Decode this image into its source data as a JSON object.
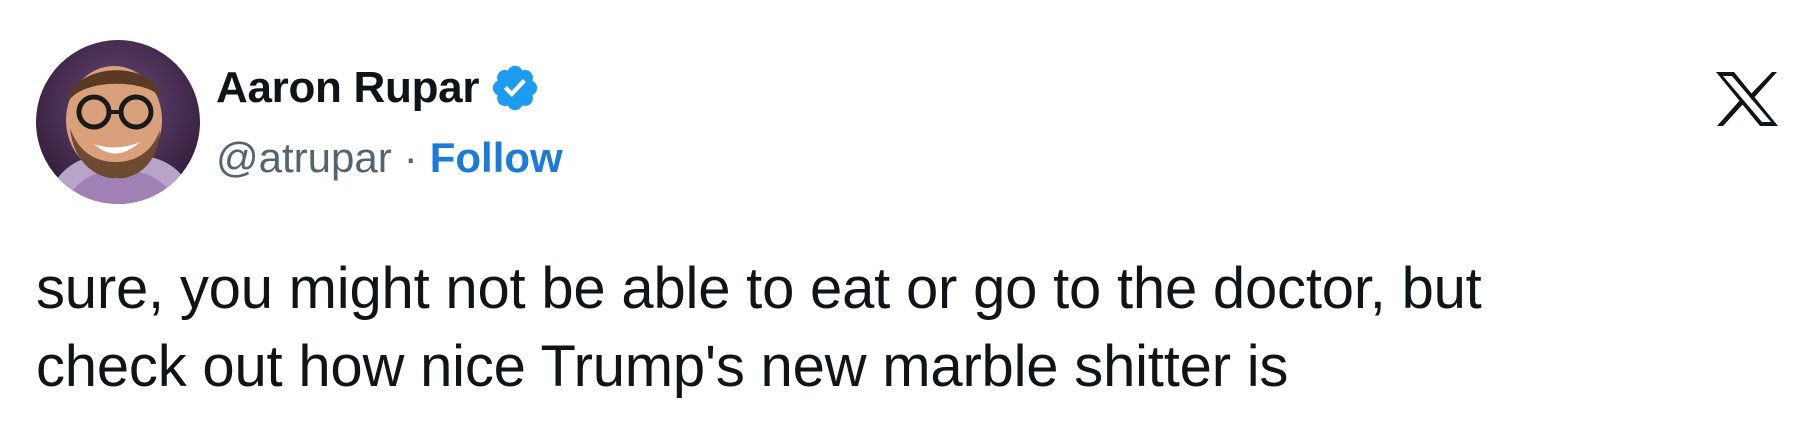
{
  "author": {
    "display_name": "Aaron Rupar",
    "handle": "@atrupar",
    "separator": "·",
    "follow_label": "Follow",
    "verified": true,
    "verified_color": "#1d9bf0",
    "follow_color": "#1d7bd8",
    "avatar_icon": "avatar-photo"
  },
  "platform": {
    "logo_icon": "x-logo-icon"
  },
  "tweet": {
    "lines": [
      "sure, you might not be able to eat or go to the doctor, but",
      "check out how nice Trump's new marble shitter is"
    ]
  }
}
